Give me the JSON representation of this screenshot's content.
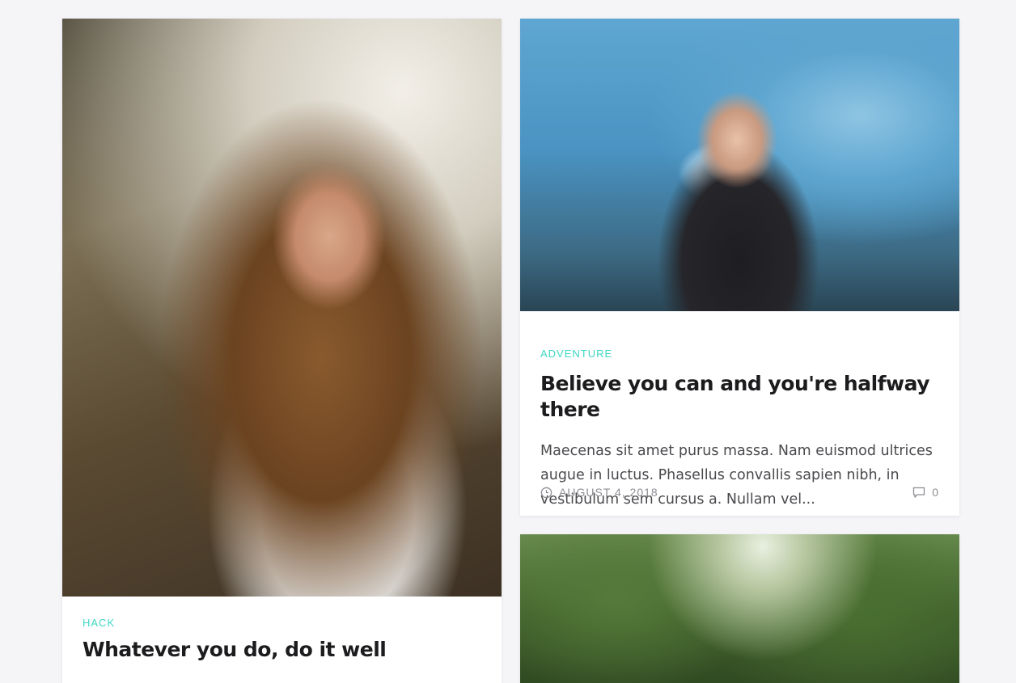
{
  "posts": [
    {
      "category": "HACK",
      "title": "Whatever you do, do it well"
    },
    {
      "category": "ADVENTURE",
      "title": "Believe you can and you're halfway there",
      "excerpt": "Maecenas sit amet purus massa. Nam euismod ultrices augue in luctus. Phasellus convallis sapien nibh, in vestibulum sem cursus a. Nullam vel...",
      "date": "AUGUST 4, 2018",
      "comments": "0"
    }
  ],
  "colors": {
    "accent": "#3fd6c4",
    "background": "#f5f5f8",
    "title": "#1c1c1e",
    "meta": "#8d8d94"
  },
  "icons": {
    "date": "clock-icon",
    "comments": "comment-icon"
  }
}
